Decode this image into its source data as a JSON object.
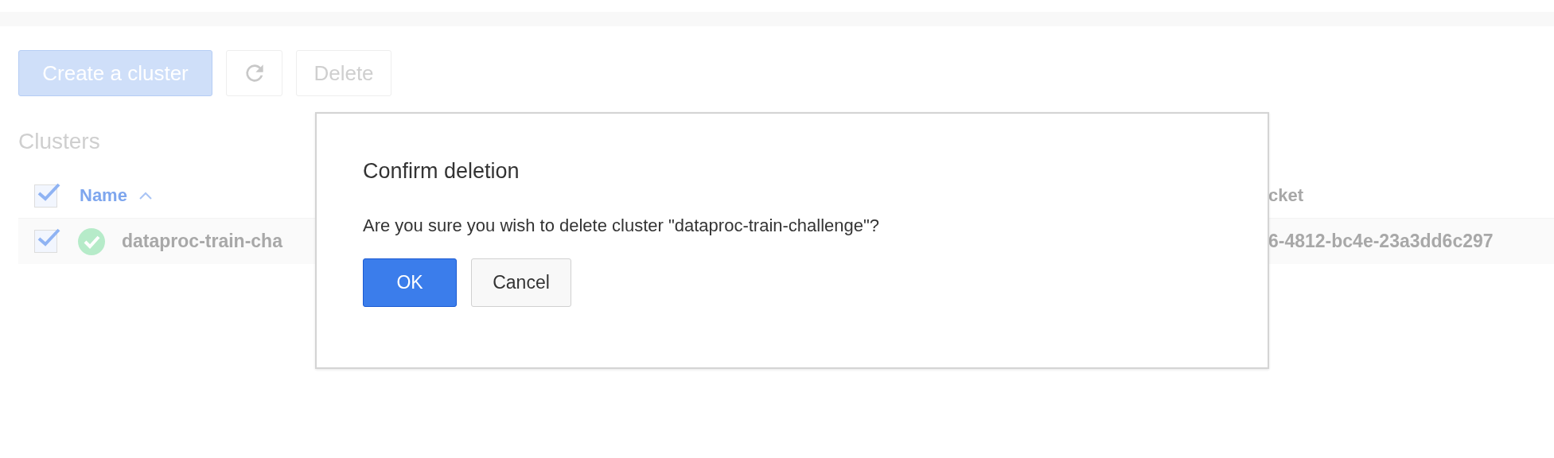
{
  "toolbar": {
    "buttons": [
      {
        "kind": "primary",
        "label": "Create a cluster"
      },
      {
        "kind": "refresh"
      },
      {
        "kind": "default",
        "label": "Delete"
      }
    ]
  },
  "section_title": "Clusters",
  "table": {
    "header_checkbox": {
      "checked": true
    },
    "columns": [
      {
        "label": "Name",
        "sort_ascending": true
      },
      {
        "label": "cket"
      }
    ],
    "rows": [
      {
        "checked": true,
        "healthy": true,
        "name": "dataproc-train-cha",
        "column_2": "6-4812-bc4e-23a3dd6c297"
      }
    ]
  },
  "dialog": {
    "title": "Confirm deletion",
    "message": "Are you sure you wish to delete cluster \"dataproc-train-challenge\"?",
    "buttons": [
      {
        "kind": "primary",
        "label": "OK"
      },
      {
        "kind": "default",
        "label": "Cancel"
      }
    ]
  }
}
